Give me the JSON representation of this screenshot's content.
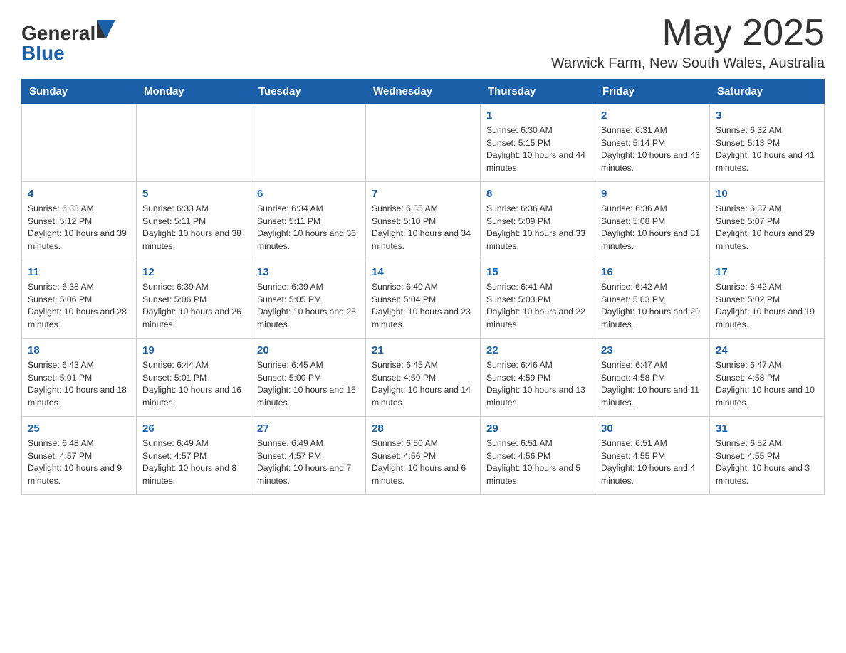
{
  "header": {
    "logo_general": "General",
    "logo_blue": "Blue",
    "month_title": "May 2025",
    "location": "Warwick Farm, New South Wales, Australia"
  },
  "days_of_week": [
    "Sunday",
    "Monday",
    "Tuesday",
    "Wednesday",
    "Thursday",
    "Friday",
    "Saturday"
  ],
  "weeks": [
    [
      {
        "day": "",
        "info": ""
      },
      {
        "day": "",
        "info": ""
      },
      {
        "day": "",
        "info": ""
      },
      {
        "day": "",
        "info": ""
      },
      {
        "day": "1",
        "info": "Sunrise: 6:30 AM\nSunset: 5:15 PM\nDaylight: 10 hours and 44 minutes."
      },
      {
        "day": "2",
        "info": "Sunrise: 6:31 AM\nSunset: 5:14 PM\nDaylight: 10 hours and 43 minutes."
      },
      {
        "day": "3",
        "info": "Sunrise: 6:32 AM\nSunset: 5:13 PM\nDaylight: 10 hours and 41 minutes."
      }
    ],
    [
      {
        "day": "4",
        "info": "Sunrise: 6:33 AM\nSunset: 5:12 PM\nDaylight: 10 hours and 39 minutes."
      },
      {
        "day": "5",
        "info": "Sunrise: 6:33 AM\nSunset: 5:11 PM\nDaylight: 10 hours and 38 minutes."
      },
      {
        "day": "6",
        "info": "Sunrise: 6:34 AM\nSunset: 5:11 PM\nDaylight: 10 hours and 36 minutes."
      },
      {
        "day": "7",
        "info": "Sunrise: 6:35 AM\nSunset: 5:10 PM\nDaylight: 10 hours and 34 minutes."
      },
      {
        "day": "8",
        "info": "Sunrise: 6:36 AM\nSunset: 5:09 PM\nDaylight: 10 hours and 33 minutes."
      },
      {
        "day": "9",
        "info": "Sunrise: 6:36 AM\nSunset: 5:08 PM\nDaylight: 10 hours and 31 minutes."
      },
      {
        "day": "10",
        "info": "Sunrise: 6:37 AM\nSunset: 5:07 PM\nDaylight: 10 hours and 29 minutes."
      }
    ],
    [
      {
        "day": "11",
        "info": "Sunrise: 6:38 AM\nSunset: 5:06 PM\nDaylight: 10 hours and 28 minutes."
      },
      {
        "day": "12",
        "info": "Sunrise: 6:39 AM\nSunset: 5:06 PM\nDaylight: 10 hours and 26 minutes."
      },
      {
        "day": "13",
        "info": "Sunrise: 6:39 AM\nSunset: 5:05 PM\nDaylight: 10 hours and 25 minutes."
      },
      {
        "day": "14",
        "info": "Sunrise: 6:40 AM\nSunset: 5:04 PM\nDaylight: 10 hours and 23 minutes."
      },
      {
        "day": "15",
        "info": "Sunrise: 6:41 AM\nSunset: 5:03 PM\nDaylight: 10 hours and 22 minutes."
      },
      {
        "day": "16",
        "info": "Sunrise: 6:42 AM\nSunset: 5:03 PM\nDaylight: 10 hours and 20 minutes."
      },
      {
        "day": "17",
        "info": "Sunrise: 6:42 AM\nSunset: 5:02 PM\nDaylight: 10 hours and 19 minutes."
      }
    ],
    [
      {
        "day": "18",
        "info": "Sunrise: 6:43 AM\nSunset: 5:01 PM\nDaylight: 10 hours and 18 minutes."
      },
      {
        "day": "19",
        "info": "Sunrise: 6:44 AM\nSunset: 5:01 PM\nDaylight: 10 hours and 16 minutes."
      },
      {
        "day": "20",
        "info": "Sunrise: 6:45 AM\nSunset: 5:00 PM\nDaylight: 10 hours and 15 minutes."
      },
      {
        "day": "21",
        "info": "Sunrise: 6:45 AM\nSunset: 4:59 PM\nDaylight: 10 hours and 14 minutes."
      },
      {
        "day": "22",
        "info": "Sunrise: 6:46 AM\nSunset: 4:59 PM\nDaylight: 10 hours and 13 minutes."
      },
      {
        "day": "23",
        "info": "Sunrise: 6:47 AM\nSunset: 4:58 PM\nDaylight: 10 hours and 11 minutes."
      },
      {
        "day": "24",
        "info": "Sunrise: 6:47 AM\nSunset: 4:58 PM\nDaylight: 10 hours and 10 minutes."
      }
    ],
    [
      {
        "day": "25",
        "info": "Sunrise: 6:48 AM\nSunset: 4:57 PM\nDaylight: 10 hours and 9 minutes."
      },
      {
        "day": "26",
        "info": "Sunrise: 6:49 AM\nSunset: 4:57 PM\nDaylight: 10 hours and 8 minutes."
      },
      {
        "day": "27",
        "info": "Sunrise: 6:49 AM\nSunset: 4:57 PM\nDaylight: 10 hours and 7 minutes."
      },
      {
        "day": "28",
        "info": "Sunrise: 6:50 AM\nSunset: 4:56 PM\nDaylight: 10 hours and 6 minutes."
      },
      {
        "day": "29",
        "info": "Sunrise: 6:51 AM\nSunset: 4:56 PM\nDaylight: 10 hours and 5 minutes."
      },
      {
        "day": "30",
        "info": "Sunrise: 6:51 AM\nSunset: 4:55 PM\nDaylight: 10 hours and 4 minutes."
      },
      {
        "day": "31",
        "info": "Sunrise: 6:52 AM\nSunset: 4:55 PM\nDaylight: 10 hours and 3 minutes."
      }
    ]
  ]
}
